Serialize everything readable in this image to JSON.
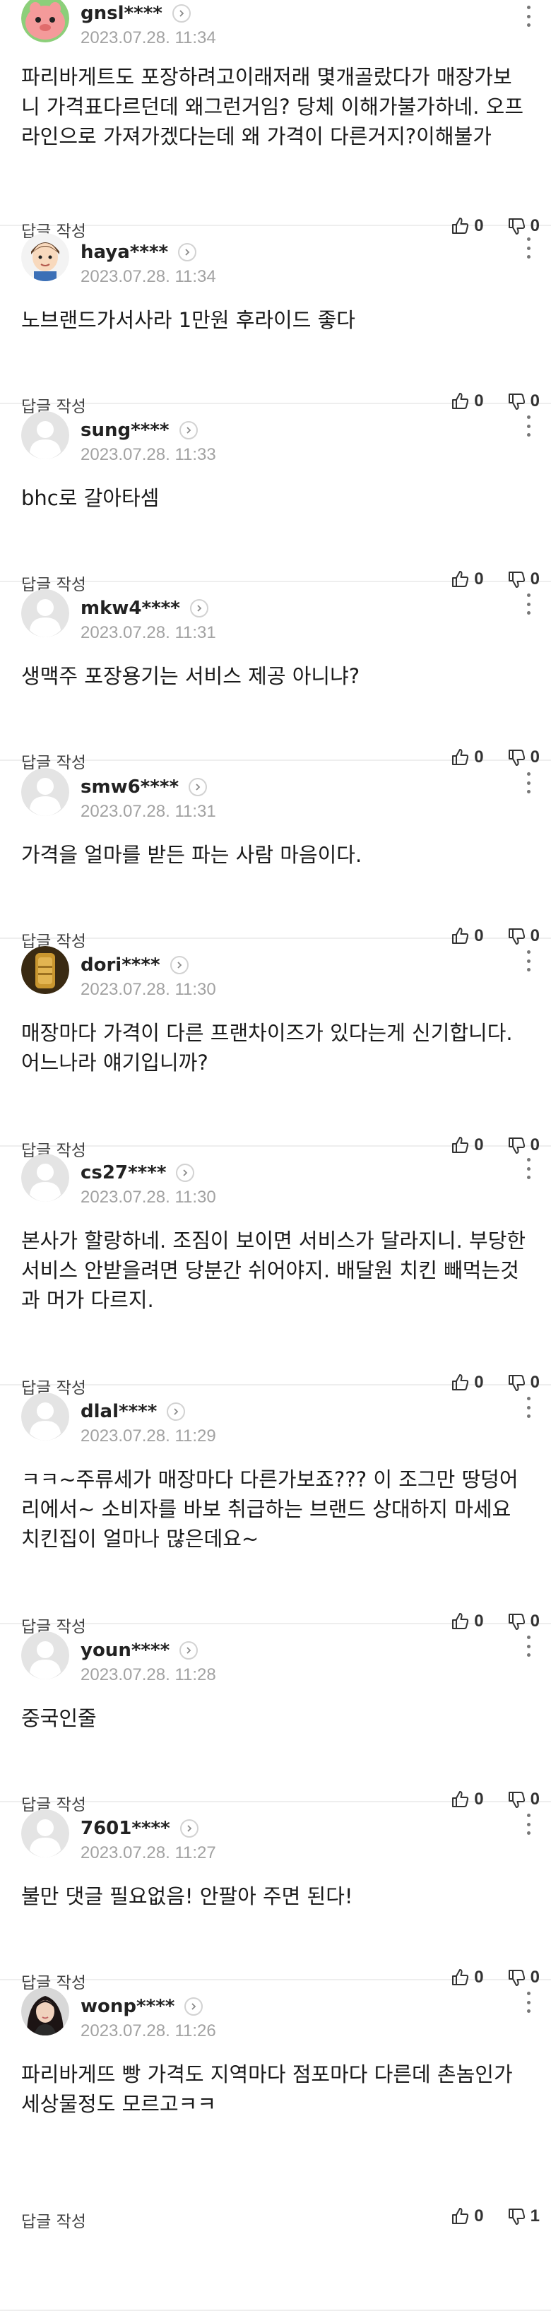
{
  "ui": {
    "reply_label": "답글 작성"
  },
  "colors": {
    "divider": "#eeeeee",
    "date": "#a2a2a2",
    "default_avatar_bg": "#e4e4e4",
    "default_avatar_fg": "#ffffff"
  },
  "comments": [
    {
      "username": "gnsl****",
      "date": "2023.07.28. 11:34",
      "text": "파리바게트도 포장하려고이래저래 몇개골랐다가 매장가보니 가격표다르던데 왜그런거임? 당체 이해가불가하네. 오프라인으로 가져가겠다는데 왜 가격이 다른거지?이해불가",
      "likes": "0",
      "dislikes": "0",
      "avatar": "pink-character-avatar"
    },
    {
      "username": "haya****",
      "date": "2023.07.28. 11:34",
      "text": "노브랜드가서사라 1만원 후라이드 좋다",
      "likes": "0",
      "dislikes": "0",
      "avatar": "cartoon-boy-avatar"
    },
    {
      "username": "sung****",
      "date": "2023.07.28. 11:33",
      "text": "bhc로 갈아타셈",
      "likes": "0",
      "dislikes": "0",
      "avatar": "default-avatar"
    },
    {
      "username": "mkw4****",
      "date": "2023.07.28. 11:31",
      "text": "생맥주 포장용기는 서비스 제공 아니냐?",
      "likes": "0",
      "dislikes": "0",
      "avatar": "default-avatar"
    },
    {
      "username": "smw6****",
      "date": "2023.07.28. 11:31",
      "text": "가격을 얼마를 받든 파는 사람 마음이다.",
      "likes": "0",
      "dislikes": "0",
      "avatar": "default-avatar"
    },
    {
      "username": "dori****",
      "date": "2023.07.28. 11:30",
      "text": "매장마다 가격이 다른 프랜차이즈가 있다는게 신기합니다. 어느나라 얘기입니까?",
      "likes": "0",
      "dislikes": "0",
      "avatar": "golden-object-avatar"
    },
    {
      "username": "cs27****",
      "date": "2023.07.28. 11:30",
      "text": "본사가 할랑하네. 조짐이 보이면 서비스가 달라지니. 부당한 서비스 안받을려면 당분간 쉬어야지. 배달원 치킨 빼먹는것과 머가 다르지.",
      "likes": "0",
      "dislikes": "0",
      "avatar": "default-avatar"
    },
    {
      "username": "dlal****",
      "date": "2023.07.28. 11:29",
      "text": "ㅋㅋ~주류세가 매장마다 다른가보죠??? 이 조그만 땅덩어리에서~ 소비자를 바보 취급하는 브랜드 상대하지 마세요 치킨집이 얼마나 많은데요~",
      "likes": "0",
      "dislikes": "0",
      "avatar": "default-avatar"
    },
    {
      "username": "youn****",
      "date": "2023.07.28. 11:28",
      "text": "중국인줄",
      "likes": "0",
      "dislikes": "0",
      "avatar": "default-avatar"
    },
    {
      "username": "7601****",
      "date": "2023.07.28. 11:27",
      "text": "불만 댓글 필요없음! 안팔아 주면 된다!",
      "likes": "0",
      "dislikes": "0",
      "avatar": "default-avatar"
    },
    {
      "username": "wonp****",
      "date": "2023.07.28. 11:26",
      "text": "파리바게뜨 빵 가격도 지역마다 점포마다 다른데 촌놈인가 세상물정도 모르고ㅋㅋ",
      "likes": "0",
      "dislikes": "1",
      "avatar": "woman-portrait-avatar"
    }
  ]
}
